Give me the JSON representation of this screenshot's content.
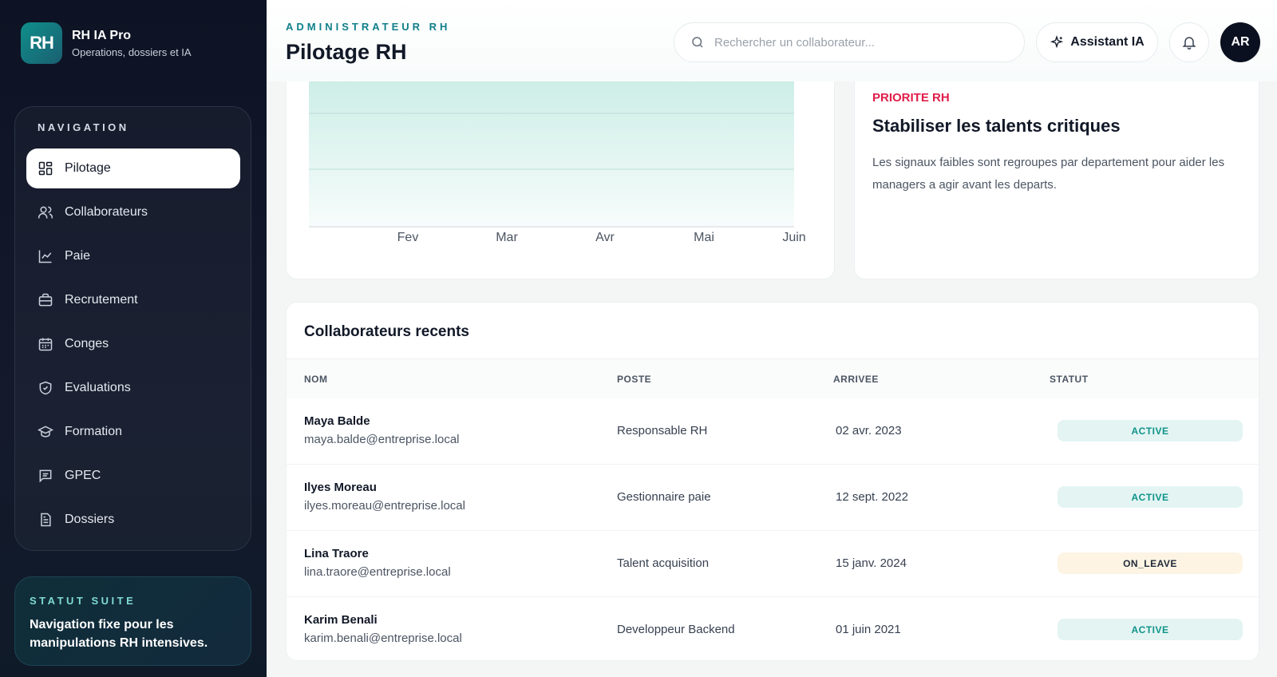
{
  "brand": {
    "logo_text": "RH",
    "name": "RH IA Pro",
    "subtitle": "Operations, dossiers et IA"
  },
  "nav": {
    "title": "NAVIGATION",
    "items": [
      {
        "label": "Pilotage",
        "icon": "dashboard-icon",
        "active": true
      },
      {
        "label": "Collaborateurs",
        "icon": "users-icon"
      },
      {
        "label": "Paie",
        "icon": "line-chart-icon"
      },
      {
        "label": "Recrutement",
        "icon": "briefcase-icon"
      },
      {
        "label": "Conges",
        "icon": "calendar-icon"
      },
      {
        "label": "Evaluations",
        "icon": "shield-check-icon"
      },
      {
        "label": "Formation",
        "icon": "graduation-cap-icon"
      },
      {
        "label": "GPEC",
        "icon": "message-icon"
      },
      {
        "label": "Dossiers",
        "icon": "file-icon"
      }
    ]
  },
  "status_suite": {
    "title": "STATUT SUITE",
    "text": "Navigation fixe pour les manipulations RH intensives."
  },
  "header": {
    "eyebrow": "ADMINISTRATEUR RH",
    "title": "Pilotage RH",
    "search_placeholder": "Rechercher un collaborateur...",
    "assistant_label": "Assistant IA",
    "avatar_initials": "AR"
  },
  "chart_data": {
    "type": "area",
    "categories": [
      "Fev",
      "Mar",
      "Avr",
      "Mai",
      "Juin"
    ],
    "fill_color": "#cdeee7",
    "grid": true
  },
  "priority": {
    "label": "PRIORITE RH",
    "title": "Stabiliser les talents critiques",
    "description": "Les signaux faibles sont regroupes par departement pour aider les managers a agir avant les departs."
  },
  "recent": {
    "title": "Collaborateurs recents",
    "columns": [
      "NOM",
      "POSTE",
      "ARRIVEE",
      "STATUT"
    ],
    "rows": [
      {
        "name": "Maya Balde",
        "email": "maya.balde@entreprise.local",
        "poste": "Responsable RH",
        "arrivee": "02 avr. 2023",
        "statut": "ACTIVE"
      },
      {
        "name": "Ilyes Moreau",
        "email": "ilyes.moreau@entreprise.local",
        "poste": "Gestionnaire paie",
        "arrivee": "12 sept. 2022",
        "statut": "ACTIVE"
      },
      {
        "name": "Lina Traore",
        "email": "lina.traore@entreprise.local",
        "poste": "Talent acquisition",
        "arrivee": "15 janv. 2024",
        "statut": "ON_LEAVE"
      },
      {
        "name": "Karim Benali",
        "email": "karim.benali@entreprise.local",
        "poste": "Developpeur Backend",
        "arrivee": "01 juin 2021",
        "statut": "ACTIVE"
      }
    ]
  }
}
